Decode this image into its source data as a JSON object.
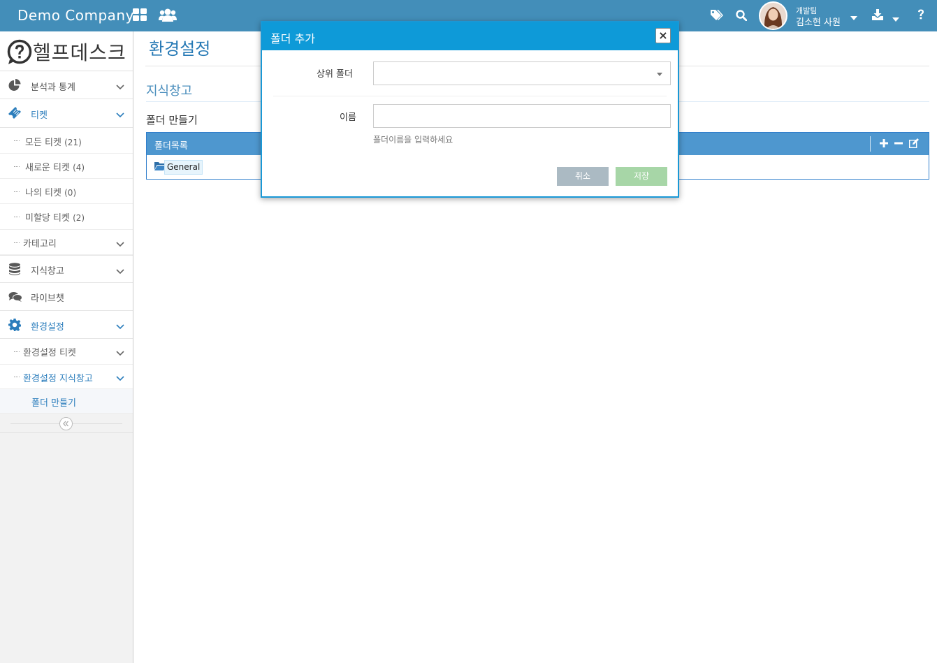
{
  "navbar": {
    "brand": "Demo Company",
    "user_team": "개발팀",
    "user_name": "김소현 사원",
    "icons": [
      "dashboard-grid-icon",
      "users-icon",
      "tags-icon",
      "search-icon",
      "download-icon",
      "help-icon"
    ]
  },
  "sidebar": {
    "logo": "헬프데스크",
    "items": [
      {
        "label": "분석과 통계",
        "icon": "pie-chart-icon"
      },
      {
        "label": "티켓",
        "icon": "ticket-icon"
      },
      {
        "label": "지식창고",
        "icon": "database-icon"
      },
      {
        "label": "라이브챗",
        "icon": "chat-icon"
      },
      {
        "label": "환경설정",
        "icon": "gear-icon"
      }
    ],
    "ticket_sub": [
      {
        "label": "모든 티켓",
        "count": "(21)"
      },
      {
        "label": "새로운 티켓",
        "count": "(4)"
      },
      {
        "label": "나의 티켓",
        "count": "(0)"
      },
      {
        "label": "미할당 티켓",
        "count": "(2)"
      },
      {
        "label": "카테고리",
        "count": ""
      }
    ],
    "settings_sub": [
      {
        "label": "환경설정 티켓"
      },
      {
        "label": "환경설정 지식창고"
      },
      {
        "label": "폴더 만들기"
      }
    ]
  },
  "main": {
    "page_title": "환경설정",
    "section_title": "지식창고",
    "sub_title": "폴더 만들기",
    "widget_title": "폴더목록",
    "tree_node": "General"
  },
  "modal": {
    "title": "폴더 추가",
    "close": "×",
    "parent_label": "상위 폴더",
    "parent_value": "",
    "name_label": "이름",
    "name_value": "",
    "name_help": "폴더이름을 입력하세요",
    "cancel_label": "취소",
    "save_label": "저장"
  },
  "colors": {
    "navbar": "#438eb9",
    "modal_header": "#0e9ad8",
    "link_blue": "#2679b5",
    "cancel_btn": "#abbac3",
    "save_btn": "#a7d6a7"
  }
}
